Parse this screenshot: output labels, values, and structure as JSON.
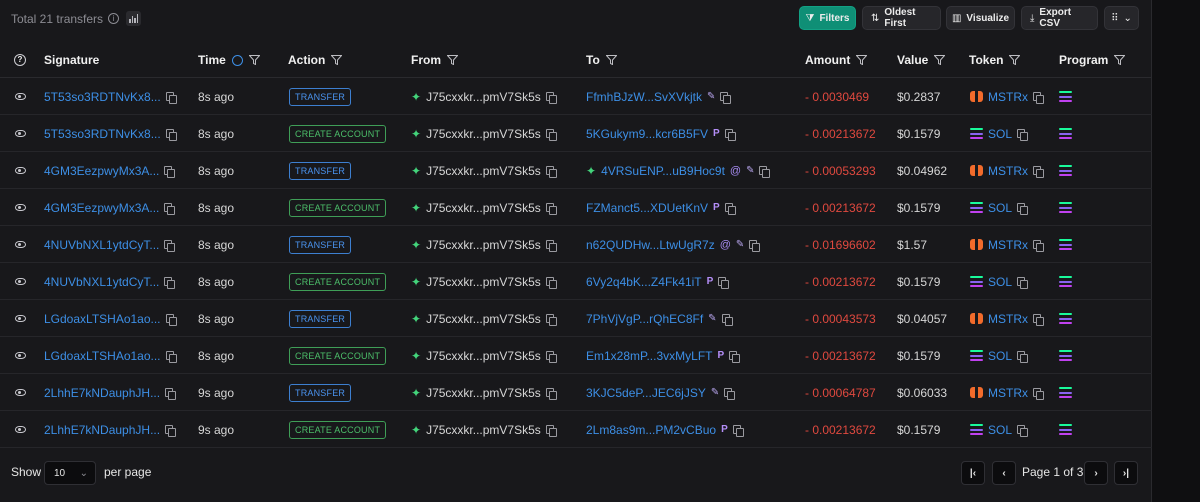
{
  "header": {
    "total_label": "Total 21 transfers",
    "buttons": {
      "filters": "Filters",
      "oldest_first": "Oldest First",
      "visualize": "Visualize",
      "export_csv": "Export CSV"
    }
  },
  "columns": {
    "signature": "Signature",
    "time": "Time",
    "action": "Action",
    "from": "From",
    "to": "To",
    "amount": "Amount",
    "value": "Value",
    "token": "Token",
    "program": "Program"
  },
  "rows": [
    {
      "signature": "5T53so3RDTNvKx8...",
      "time": "8s ago",
      "action": "TRANSFER",
      "action_type": "transfer",
      "from": "J75cxxkr...pmV7Sk5s",
      "to": "FfmhBJzW...SvXVkjtk",
      "to_badges": [
        "pencil"
      ],
      "to_icon": "",
      "amount": "- 0.0030469",
      "value": "$0.2837",
      "token": "MSTRx",
      "token_icon": "mstrx"
    },
    {
      "signature": "5T53so3RDTNvKx8...",
      "time": "8s ago",
      "action": "CREATE ACCOUNT",
      "action_type": "create",
      "from": "J75cxxkr...pmV7Sk5s",
      "to": "5KGukym9...kcr6B5FV",
      "to_badges": [
        "p"
      ],
      "to_icon": "",
      "amount": "- 0.00213672",
      "value": "$0.1579",
      "token": "SOL",
      "token_icon": "sol"
    },
    {
      "signature": "4GM3EezpwyMx3A...",
      "time": "8s ago",
      "action": "TRANSFER",
      "action_type": "transfer",
      "from": "J75cxxkr...pmV7Sk5s",
      "to": "4VRSuENP...uB9Hoc9t",
      "to_badges": [
        "at",
        "pencil"
      ],
      "to_icon": "sparkle",
      "amount": "- 0.00053293",
      "value": "$0.04962",
      "token": "MSTRx",
      "token_icon": "mstrx"
    },
    {
      "signature": "4GM3EezpwyMx3A...",
      "time": "8s ago",
      "action": "CREATE ACCOUNT",
      "action_type": "create",
      "from": "J75cxxkr...pmV7Sk5s",
      "to": "FZManct5...XDUetKnV",
      "to_badges": [
        "p"
      ],
      "to_icon": "",
      "amount": "- 0.00213672",
      "value": "$0.1579",
      "token": "SOL",
      "token_icon": "sol"
    },
    {
      "signature": "4NUVbNXL1ytdCyT...",
      "time": "8s ago",
      "action": "TRANSFER",
      "action_type": "transfer",
      "from": "J75cxxkr...pmV7Sk5s",
      "to": "n62QUDHw...LtwUgR7z",
      "to_badges": [
        "at",
        "pencil"
      ],
      "to_icon": "",
      "amount": "- 0.01696602",
      "value": "$1.57",
      "token": "MSTRx",
      "token_icon": "mstrx"
    },
    {
      "signature": "4NUVbNXL1ytdCyT...",
      "time": "8s ago",
      "action": "CREATE ACCOUNT",
      "action_type": "create",
      "from": "J75cxxkr...pmV7Sk5s",
      "to": "6Vy2q4bK...Z4Fk41iT",
      "to_badges": [
        "p"
      ],
      "to_icon": "",
      "amount": "- 0.00213672",
      "value": "$0.1579",
      "token": "SOL",
      "token_icon": "sol"
    },
    {
      "signature": "LGdoaxLTSHAo1ao...",
      "time": "8s ago",
      "action": "TRANSFER",
      "action_type": "transfer",
      "from": "J75cxxkr...pmV7Sk5s",
      "to": "7PhVjVgP...rQhEC8Ff",
      "to_badges": [
        "pencil"
      ],
      "to_icon": "",
      "amount": "- 0.00043573",
      "value": "$0.04057",
      "token": "MSTRx",
      "token_icon": "mstrx"
    },
    {
      "signature": "LGdoaxLTSHAo1ao...",
      "time": "8s ago",
      "action": "CREATE ACCOUNT",
      "action_type": "create",
      "from": "J75cxxkr...pmV7Sk5s",
      "to": "Em1x28mP...3vxMyLFT",
      "to_badges": [
        "p"
      ],
      "to_icon": "",
      "amount": "- 0.00213672",
      "value": "$0.1579",
      "token": "SOL",
      "token_icon": "sol"
    },
    {
      "signature": "2LhhE7kNDauphJH...",
      "time": "9s ago",
      "action": "TRANSFER",
      "action_type": "transfer",
      "from": "J75cxxkr...pmV7Sk5s",
      "to": "3KJC5deP...JEC6jJSY",
      "to_badges": [
        "pencil"
      ],
      "to_icon": "",
      "amount": "- 0.00064787",
      "value": "$0.06033",
      "token": "MSTRx",
      "token_icon": "mstrx"
    },
    {
      "signature": "2LhhE7kNDauphJH...",
      "time": "9s ago",
      "action": "CREATE ACCOUNT",
      "action_type": "create",
      "from": "J75cxxkr...pmV7Sk5s",
      "to": "2Lm8as9m...PM2vCBuo",
      "to_badges": [
        "p"
      ],
      "to_icon": "",
      "amount": "- 0.00213672",
      "value": "$0.1579",
      "token": "SOL",
      "token_icon": "sol"
    }
  ],
  "footer": {
    "show_label": "Show",
    "page_size": "10",
    "per_page_label": "per page",
    "page_label": "Page 1 of 3"
  },
  "colors": {
    "accent": "#0f8f76",
    "link": "#3d8fe6",
    "negative": "#e0493f",
    "transfer_badge": "#4a93ef",
    "create_badge": "#4cbf6a"
  }
}
